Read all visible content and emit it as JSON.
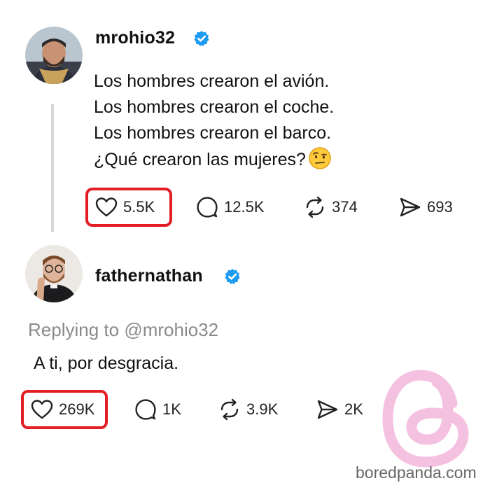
{
  "post": {
    "username": "mrohio32",
    "lines": [
      "Los hombres crearon el avión.",
      "Los hombres crearon el coche.",
      "Los hombres crearon el barco.",
      "¿Qué crearon las mujeres?"
    ],
    "emoji": "🤨",
    "likes": "5.5K",
    "comments": "12.5K",
    "reposts": "374",
    "shares": "693"
  },
  "reply": {
    "username": "fathernathan",
    "replying_prefix": "Replying to",
    "replying_handle": "@mrohio32",
    "text": "A ti, por desgracia.",
    "likes": "269K",
    "comments": "1K",
    "reposts": "3.9K",
    "shares": "2K"
  },
  "watermark": "boredpanda.com",
  "colors": {
    "verified": "#1d9bf0",
    "highlight": "#e31d24",
    "threads_logo": "#f3b6dc"
  },
  "icons": [
    "heart-icon",
    "comment-icon",
    "repost-icon",
    "share-icon",
    "verified-icon",
    "threads-logo-icon"
  ]
}
